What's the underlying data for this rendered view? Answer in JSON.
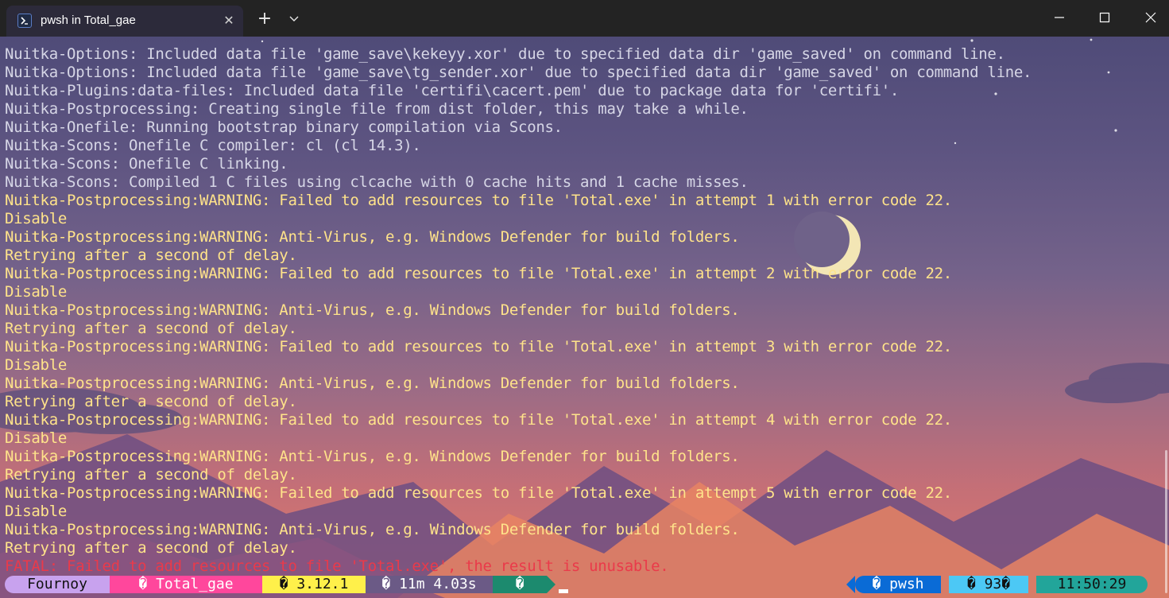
{
  "tab": {
    "title": "pwsh in Total_gae",
    "close_glyph": "✕",
    "new_tab_glyph": "+",
    "dropdown_glyph": "⌄"
  },
  "icons": [
    "powershell-icon",
    "close-icon",
    "plus-icon",
    "chevron-down-icon",
    "minimize-icon",
    "maximize-icon",
    "window-close-icon",
    "moon-icon"
  ],
  "colors": {
    "info_text": "#d6d6e6",
    "warning_text": "#ffe38a",
    "fatal_text": "#ea3a4a",
    "user_segment": "#c8a2ee",
    "path_segment": "#ff479c",
    "python_segment": "#fff04a",
    "time_segment": "#6b5a86",
    "status_segment": "#1c8a6e",
    "shell_segment": "#0a6bd6",
    "exit_segment": "#4cc8f5",
    "clock_segment": "#22a59a"
  },
  "terminal": {
    "lines": [
      {
        "level": "info",
        "text": "Nuitka-Options: Included data file 'game_save\\kekeyy.xor' due to specified data dir 'game_saved' on command line."
      },
      {
        "level": "info",
        "text": "Nuitka-Options: Included data file 'game_save\\tg_sender.xor' due to specified data dir 'game_saved' on command line."
      },
      {
        "level": "info",
        "text": "Nuitka-Plugins:data-files: Included data file 'certifi\\cacert.pem' due to package data for 'certifi'."
      },
      {
        "level": "info",
        "text": "Nuitka-Postprocessing: Creating single file from dist folder, this may take a while."
      },
      {
        "level": "info",
        "text": "Nuitka-Onefile: Running bootstrap binary compilation via Scons."
      },
      {
        "level": "info",
        "text": "Nuitka-Scons: Onefile C compiler: cl (cl 14.3)."
      },
      {
        "level": "info",
        "text": "Nuitka-Scons: Onefile C linking."
      },
      {
        "level": "info",
        "text": "Nuitka-Scons: Compiled 1 C files using clcache with 0 cache hits and 1 cache misses."
      },
      {
        "level": "warn",
        "text": "Nuitka-Postprocessing:WARNING: Failed to add resources to file 'Total.exe' in attempt 1 with error code 22."
      },
      {
        "level": "warn",
        "text": "Disable"
      },
      {
        "level": "warn",
        "text": "Nuitka-Postprocessing:WARNING: Anti-Virus, e.g. Windows Defender for build folders."
      },
      {
        "level": "warn",
        "text": "Retrying after a second of delay."
      },
      {
        "level": "warn",
        "text": "Nuitka-Postprocessing:WARNING: Failed to add resources to file 'Total.exe' in attempt 2 with error code 22."
      },
      {
        "level": "warn",
        "text": "Disable"
      },
      {
        "level": "warn",
        "text": "Nuitka-Postprocessing:WARNING: Anti-Virus, e.g. Windows Defender for build folders."
      },
      {
        "level": "warn",
        "text": "Retrying after a second of delay."
      },
      {
        "level": "warn",
        "text": "Nuitka-Postprocessing:WARNING: Failed to add resources to file 'Total.exe' in attempt 3 with error code 22."
      },
      {
        "level": "warn",
        "text": "Disable"
      },
      {
        "level": "warn",
        "text": "Nuitka-Postprocessing:WARNING: Anti-Virus, e.g. Windows Defender for build folders."
      },
      {
        "level": "warn",
        "text": "Retrying after a second of delay."
      },
      {
        "level": "warn",
        "text": "Nuitka-Postprocessing:WARNING: Failed to add resources to file 'Total.exe' in attempt 4 with error code 22."
      },
      {
        "level": "warn",
        "text": "Disable"
      },
      {
        "level": "warn",
        "text": "Nuitka-Postprocessing:WARNING: Anti-Virus, e.g. Windows Defender for build folders."
      },
      {
        "level": "warn",
        "text": "Retrying after a second of delay."
      },
      {
        "level": "warn",
        "text": "Nuitka-Postprocessing:WARNING: Failed to add resources to file 'Total.exe' in attempt 5 with error code 22."
      },
      {
        "level": "warn",
        "text": "Disable"
      },
      {
        "level": "warn",
        "text": "Nuitka-Postprocessing:WARNING: Anti-Virus, e.g. Windows Defender for build folders."
      },
      {
        "level": "warn",
        "text": "Retrying after a second of delay."
      },
      {
        "level": "fatal",
        "text": "FATAL: Failed to add resources to file 'Total.exe', the result is unusable."
      }
    ]
  },
  "prompt": {
    "user": "Fournoy",
    "path": "� Total_gae",
    "python_version": "� 3.12.1",
    "duration": "� 11m 4.03s",
    "status": "�",
    "shell": "� pwsh",
    "exit_code": "� 93�",
    "clock": "11:50:29"
  }
}
